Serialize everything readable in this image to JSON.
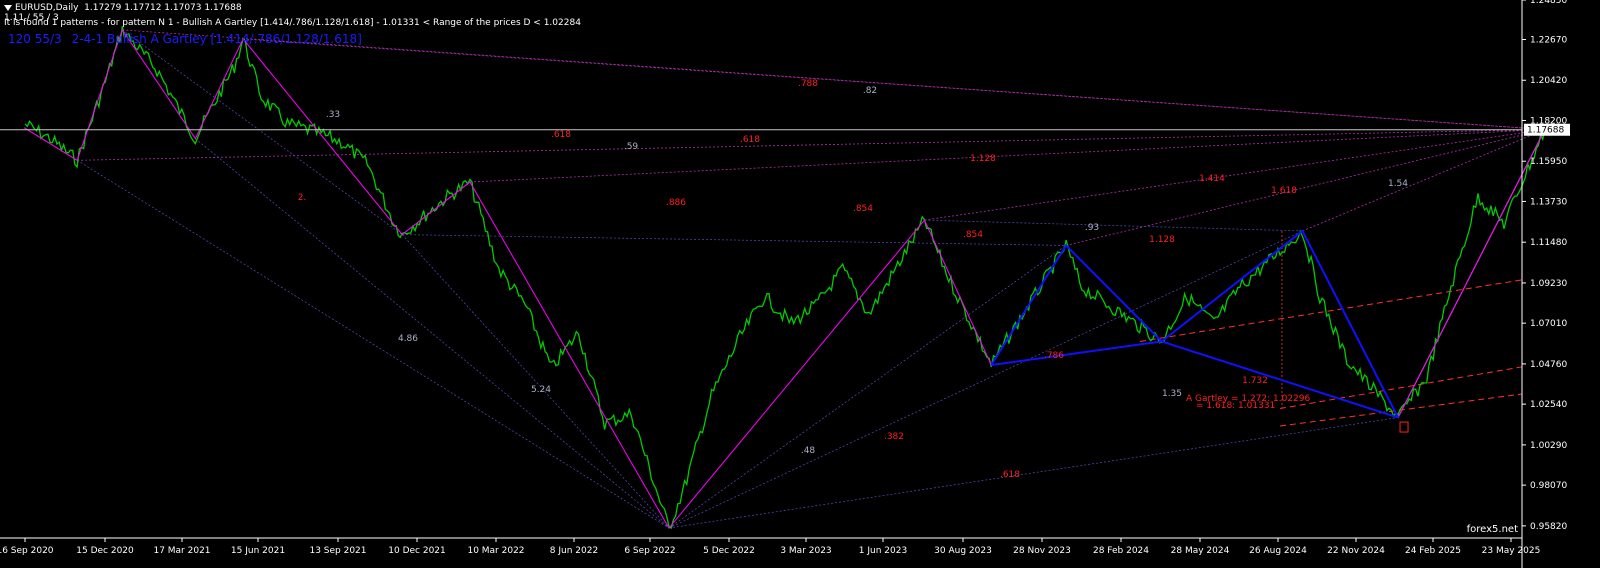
{
  "header": {
    "symbol": "EURUSD,Daily",
    "ohlc": "1.17279 1.17712 1.17073 1.17688",
    "indicator_line": "1.11 / 55 / 3",
    "pattern_info": "It is found 1 patterns  -  for pattern N 1 - Bullish A Gartley [1.414/.786/1.128/1.618]  - 1.01331 < Range of the prices D < 1.02284"
  },
  "pattern_label": {
    "params": "120 55/3",
    "pattern_name": "2-4-1 Bullish A Gartley [1.414/.786/1.128/1.618]"
  },
  "watermark": "forex5.net",
  "colors": {
    "background": "#000000",
    "price": "#00cc00",
    "zigzag": "#ff00ff",
    "pattern": "#1010ff",
    "ratio_text": "#ff2020",
    "grid_text": "#ffffff",
    "target_lines": "#ff3030",
    "current_price_line": "#c8c8c8"
  },
  "chart_data": {
    "type": "line",
    "title": "EURUSD,Daily",
    "x_ticks": [
      "16 Sep 2020",
      "15 Dec 2020",
      "17 Mar 2021",
      "15 Jun 2021",
      "13 Sep 2021",
      "10 Dec 2021",
      "10 Mar 2022",
      "8 Jun 2022",
      "6 Sep 2022",
      "5 Dec 2022",
      "3 Mar 2023",
      "1 Jun 2023",
      "30 Aug 2023",
      "28 Nov 2023",
      "28 Feb 2024",
      "28 May 2024",
      "26 Aug 2024",
      "22 Nov 2024",
      "24 Feb 2025",
      "23 May 2025"
    ],
    "y_ticks": [
      "1.24850",
      "1.22670",
      "1.20420",
      "1.18200",
      "1.15950",
      "1.13730",
      "1.11480",
      "1.09230",
      "1.07010",
      "1.04760",
      "1.02540",
      "1.00290",
      "0.98070",
      "0.95820"
    ],
    "ylim": [
      0.9515,
      1.2485
    ],
    "current_price": "1.17688",
    "series": [
      {
        "name": "Close",
        "points": [
          [
            "16 Sep 2020",
            1.18
          ],
          [
            "Oct 2020",
            1.172
          ],
          [
            "Nov 2020",
            1.16
          ],
          [
            "Dec 2020",
            1.2
          ],
          [
            "6 Jan 2021",
            1.232
          ],
          [
            "Feb 2021",
            1.21
          ],
          [
            "31 Mar 2021",
            1.172
          ],
          [
            "May 2021",
            1.212
          ],
          [
            "25 May 2021",
            1.227
          ],
          [
            "Jun 2021",
            1.195
          ],
          [
            "Jul 2021",
            1.18
          ],
          [
            "Aug 2021",
            1.176
          ],
          [
            "Sep 2021",
            1.17
          ],
          [
            "Oct 2021",
            1.158
          ],
          [
            "Nov 2021",
            1.125
          ],
          [
            "24 Nov 2021",
            1.119
          ],
          [
            "Jan 2022",
            1.14
          ],
          [
            "10 Feb 2022",
            1.148
          ],
          [
            "Mar 2022",
            1.1
          ],
          [
            "Apr 2022",
            1.08
          ],
          [
            "May 2022",
            1.045
          ],
          [
            "Jun 2022",
            1.065
          ],
          [
            "Jul 2022",
            1.015
          ],
          [
            "Aug 2022",
            1.02
          ],
          [
            "27 Sep 2022",
            0.957
          ],
          [
            "Oct 2022",
            0.98
          ],
          [
            "Nov 2022",
            1.03
          ],
          [
            "Dec 2022",
            1.06
          ],
          [
            "Jan 2023",
            1.085
          ],
          [
            "Feb 2023",
            1.07
          ],
          [
            "Mar 2023",
            1.08
          ],
          [
            "Apr 2023",
            1.1
          ],
          [
            "May 2023",
            1.075
          ],
          [
            "18 Jul 2023",
            1.127
          ],
          [
            "Aug 2023",
            1.095
          ],
          [
            "3 Oct 2023",
            1.047
          ],
          [
            "Nov 2023",
            1.08
          ],
          [
            "28 Dec 2023",
            1.113
          ],
          [
            "Jan 2024",
            1.09
          ],
          [
            "Feb 2024",
            1.08
          ],
          [
            "16 Apr 2024",
            1.06
          ],
          [
            "May 2024",
            1.085
          ],
          [
            "Jun 2024",
            1.07
          ],
          [
            "Jul 2024",
            1.09
          ],
          [
            "25 Sep 2024",
            1.121
          ],
          [
            "Oct 2024",
            1.085
          ],
          [
            "Nov 2024",
            1.05
          ],
          [
            "13 Jan 2025",
            1.018
          ],
          [
            "Feb 2025",
            1.04
          ],
          [
            "Mar 2025",
            1.09
          ],
          [
            "Apr 2025",
            1.14
          ],
          [
            "May 2025",
            1.125
          ],
          [
            "1 Jul 2025",
            1.177
          ]
        ]
      }
    ],
    "zigzag_points": [
      [
        "Sep 2020",
        1.178
      ],
      [
        "Nov 2020",
        1.16
      ],
      [
        "6 Jan 2021",
        1.232
      ],
      [
        "31 Mar 2021",
        1.172
      ],
      [
        "25 May 2021",
        1.227
      ],
      [
        "24 Nov 2021",
        1.119
      ],
      [
        "10 Feb 2022",
        1.148
      ],
      [
        "27 Sep 2022",
        0.957
      ],
      [
        "18 Jul 2023",
        1.127
      ],
      [
        "3 Oct 2023",
        1.047
      ],
      [
        "28 Dec 2023",
        1.113
      ],
      [
        "16 Apr 2024",
        1.06
      ],
      [
        "25 Sep 2024",
        1.121
      ],
      [
        "13 Jan 2025",
        1.018
      ],
      [
        "1 Jul 2025",
        1.177
      ]
    ],
    "pattern_points": [
      [
        "3 Oct 2023",
        1.047
      ],
      [
        "28 Dec 2023",
        1.113
      ],
      [
        "16 Apr 2024",
        1.06
      ],
      [
        "25 Sep 2024",
        1.121
      ],
      [
        "13 Jan 2025",
        1.018
      ]
    ],
    "annotations": {
      "grey": [
        ".33",
        ".59",
        ".82",
        ".93",
        "1.54",
        "4.86",
        "5.24",
        ".48",
        "1.35"
      ],
      "red": [
        ".788",
        ".618",
        ".618",
        "2.",
        ".886",
        ".854",
        ".854",
        "1.128",
        "1.414",
        "1.618",
        "1.128",
        ".786",
        "1.732",
        ".382",
        ".618"
      ],
      "target_1": "A Gartley = 1.272: 1.02296",
      "target_2": "= 1.618: 1.01331"
    }
  }
}
